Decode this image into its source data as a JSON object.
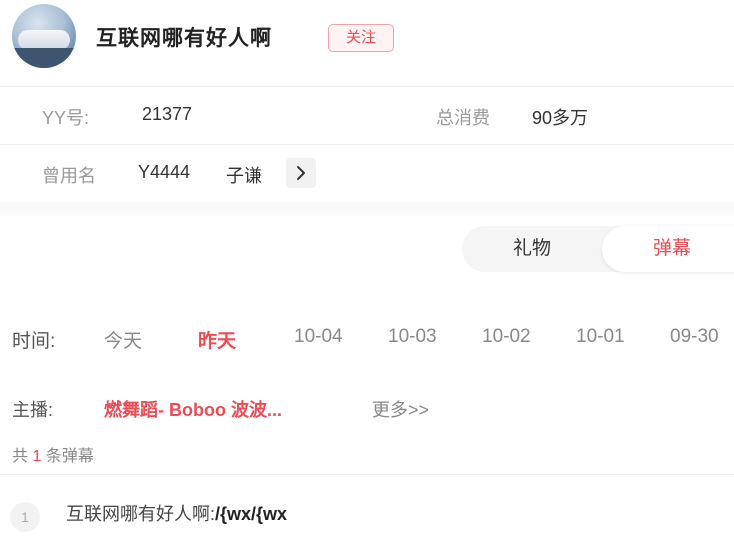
{
  "profile": {
    "username": "互联网哪有好人啊",
    "follow_label": "关注"
  },
  "info": {
    "yy_label": "YY号:",
    "yy_value": "21377",
    "spend_label": "总消费",
    "spend_value": "90多万",
    "alias_label": "曾用名",
    "alias_values": [
      "Y4444",
      "子谦"
    ]
  },
  "tabs": {
    "gift_label": "礼物",
    "danmu_label": "弹幕",
    "active": "弹幕"
  },
  "dates": {
    "label": "时间:",
    "items": [
      "今天",
      "昨天",
      "10-04",
      "10-03",
      "10-02",
      "10-01",
      "09-30"
    ],
    "active": "昨天"
  },
  "host": {
    "label": "主播:",
    "name": "燃舞蹈- Boboo 波波...",
    "more_label": "更多>>"
  },
  "count": {
    "prefix": "共",
    "number": "1",
    "suffix": "条弹幕"
  },
  "messages": [
    {
      "index": "1",
      "sender": "互联网哪有好人啊:",
      "content": "/{wx/{wx"
    }
  ],
  "colors": {
    "accent": "#ee4b55",
    "muted": "#999999"
  }
}
